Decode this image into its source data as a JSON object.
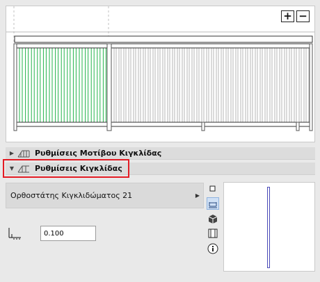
{
  "preview": {
    "zoom_in_label": "+",
    "zoom_out_label": "−"
  },
  "sections": {
    "pattern_settings_label": "Ρυθμίσεις Μοτίβου Κιγκλίδας",
    "railing_settings_label": "Ρυθμίσεις Κιγκλίδας"
  },
  "dropdown": {
    "selected": "Ορθοστάτης Κιγκλιδώματος 21"
  },
  "width_field": {
    "value": "0.100"
  },
  "colors": {
    "selected_balusters": "#22b34a",
    "highlight": "#e31b23",
    "mini_profile": "#4a4ab8"
  }
}
